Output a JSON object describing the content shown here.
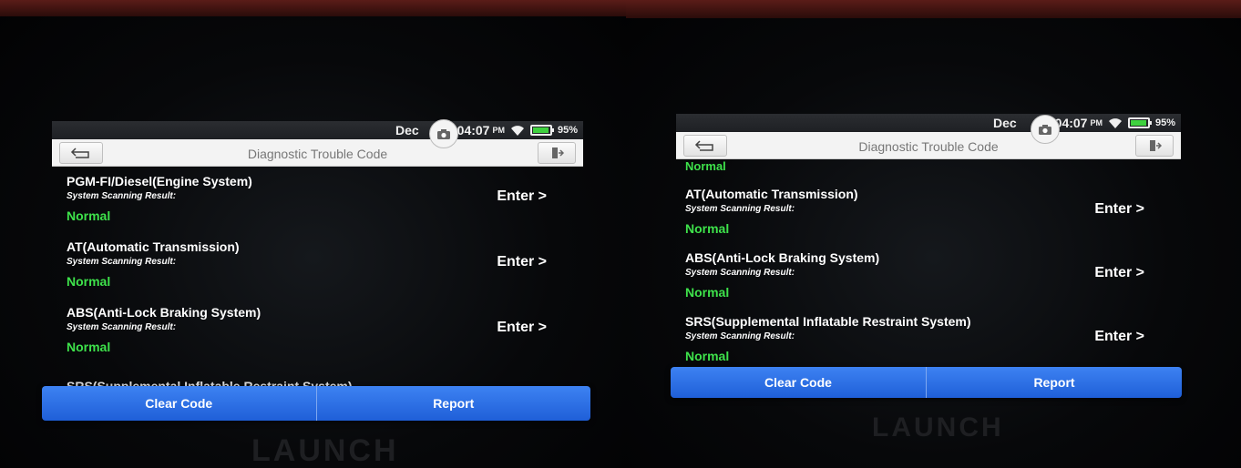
{
  "status": {
    "date": "Dec",
    "time": "04:07",
    "ampm": "PM",
    "battery": "95%",
    "battery_level": 0.95
  },
  "header": {
    "title": "Diagnostic Trouble Code"
  },
  "left": {
    "rows": [
      {
        "system": "PGM-FI/Diesel(Engine System)",
        "label": "System Scanning Result:",
        "result": "Normal",
        "enter": "Enter >"
      },
      {
        "system": "AT(Automatic Transmission)",
        "label": "System Scanning Result:",
        "result": "Normal",
        "enter": "Enter >"
      },
      {
        "system": "ABS(Anti-Lock Braking System)",
        "label": "System Scanning Result:",
        "result": "Normal",
        "enter": "Enter >"
      }
    ],
    "partial_row": "SRS(Supplemental Inflatable Restraint System)"
  },
  "right": {
    "top_result": "Normal",
    "rows": [
      {
        "system": "AT(Automatic Transmission)",
        "label": "System Scanning Result:",
        "result": "Normal",
        "enter": "Enter >"
      },
      {
        "system": "ABS(Anti-Lock Braking System)",
        "label": "System Scanning Result:",
        "result": "Normal",
        "enter": "Enter >"
      },
      {
        "system": "SRS(Supplemental Inflatable Restraint System)",
        "label": "System Scanning Result:",
        "result": "Normal",
        "enter": "Enter >"
      }
    ]
  },
  "actions": {
    "clear_code": "Clear Code",
    "report": "Report"
  },
  "brand": "LAUNCH",
  "colors": {
    "result_green": "#3ee24b",
    "action_blue": "#2a6fe6",
    "header_bg": "#f3f3f3"
  }
}
